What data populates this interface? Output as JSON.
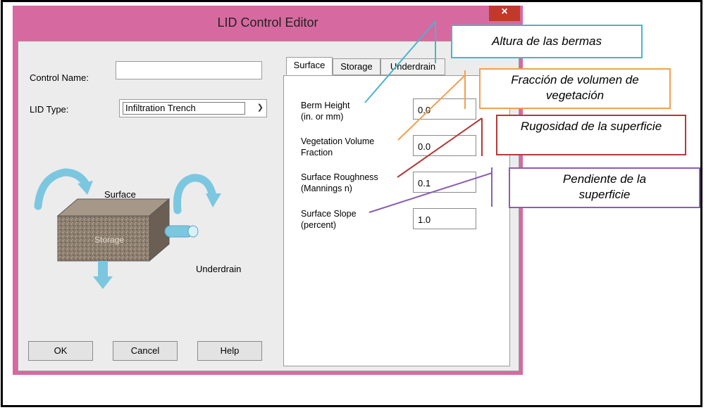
{
  "window": {
    "title": "LID Control Editor",
    "close_glyph": "×"
  },
  "form": {
    "control_name_label": "Control Name:",
    "control_name_value": "",
    "lid_type_label": "LID Type:",
    "lid_type_value": "Infiltration Trench"
  },
  "diagram": {
    "surface": "Surface",
    "storage": "Storage",
    "underdrain": "Underdrain"
  },
  "buttons": {
    "ok": "OK",
    "cancel": "Cancel",
    "help": "Help"
  },
  "tabs": [
    {
      "label": "Surface",
      "active": true
    },
    {
      "label": "Storage",
      "active": false
    },
    {
      "label": "Underdrain",
      "active": false
    }
  ],
  "params": [
    {
      "line1": "Berm Height",
      "line2": "(in. or mm)",
      "value": "0.0"
    },
    {
      "line1": "Vegetation Volume",
      "line2": "Fraction",
      "value": "0.0"
    },
    {
      "line1": "Surface Roughness",
      "line2": "(Mannings n)",
      "value": "0.1"
    },
    {
      "line1": "Surface Slope",
      "line2": "(percent)",
      "value": "1.0"
    }
  ],
  "callouts": [
    {
      "text": "Altura de las bermas",
      "color": "#4bb3cc"
    },
    {
      "text": "Fracción de volumen de vegetación",
      "color": "#f0a050"
    },
    {
      "text": "Rugosidad de la superficie",
      "color": "#b33a3a"
    },
    {
      "text": "Pendiente de la superficie",
      "color": "#8a5fb0"
    }
  ],
  "colors": {
    "titlebar": "#d66aa0",
    "arrows": "#7cc7e0",
    "storage_block": "#8c7d6e"
  }
}
